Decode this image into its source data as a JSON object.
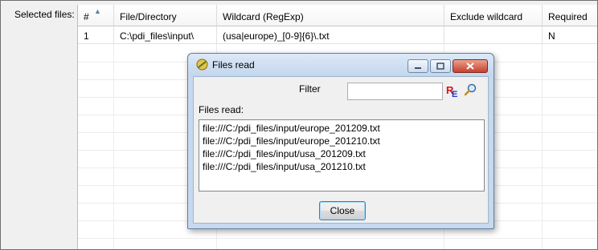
{
  "selected_files_label": "Selected files:",
  "table": {
    "headers": [
      "#",
      "File/Directory",
      "Wildcard (RegExp)",
      "Exclude wildcard",
      "Required"
    ],
    "rows": [
      [
        "1",
        "C:\\pdi_files\\input\\",
        "(usa|europe)_[0-9]{6}\\.txt",
        "",
        "N"
      ]
    ]
  },
  "dialog": {
    "title": "Files read",
    "filter_label": "Filter",
    "filter_value": "",
    "files_read_label": "Files read:",
    "files": [
      "file:///C:/pdi_files/input/europe_201209.txt",
      "file:///C:/pdi_files/input/europe_201210.txt",
      "file:///C:/pdi_files/input/usa_201209.txt",
      "file:///C:/pdi_files/input/usa_201210.txt"
    ],
    "close_label": "Close"
  },
  "icons": {
    "app": "kettle-app-icon",
    "regex": "regex-icon",
    "search": "search-icon",
    "sort": "sort-ascending-icon"
  }
}
